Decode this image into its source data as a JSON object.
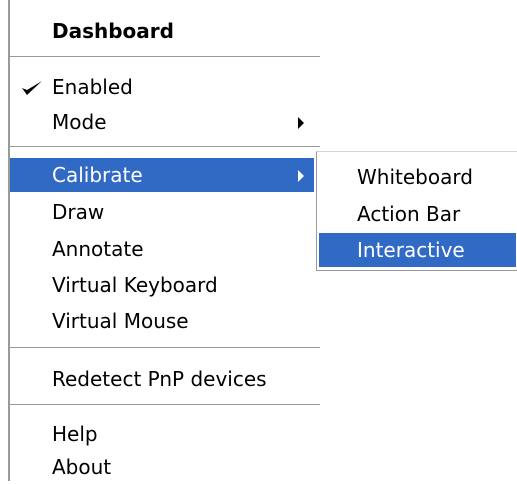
{
  "menu": {
    "title": "Dashboard",
    "items": [
      {
        "label": "Enabled",
        "checked": true
      },
      {
        "label": "Mode",
        "has_submenu": true
      },
      {
        "label": "Calibrate",
        "has_submenu": true,
        "highlighted": true
      },
      {
        "label": "Draw"
      },
      {
        "label": "Annotate"
      },
      {
        "label": "Virtual Keyboard"
      },
      {
        "label": "Virtual Mouse"
      },
      {
        "label": "Redetect PnP devices"
      },
      {
        "label": "Help"
      },
      {
        "label": "About"
      }
    ]
  },
  "submenu": {
    "items": [
      {
        "label": "Whiteboard"
      },
      {
        "label": "Action Bar"
      },
      {
        "label": "Interactive",
        "highlighted": true
      }
    ]
  },
  "colors": {
    "highlight": "#316ac5",
    "highlight_text": "#ffffff",
    "separator": "#9a9a9a"
  },
  "icons": {
    "check": "check-icon",
    "submenu_arrow": "chevron-right-icon"
  }
}
